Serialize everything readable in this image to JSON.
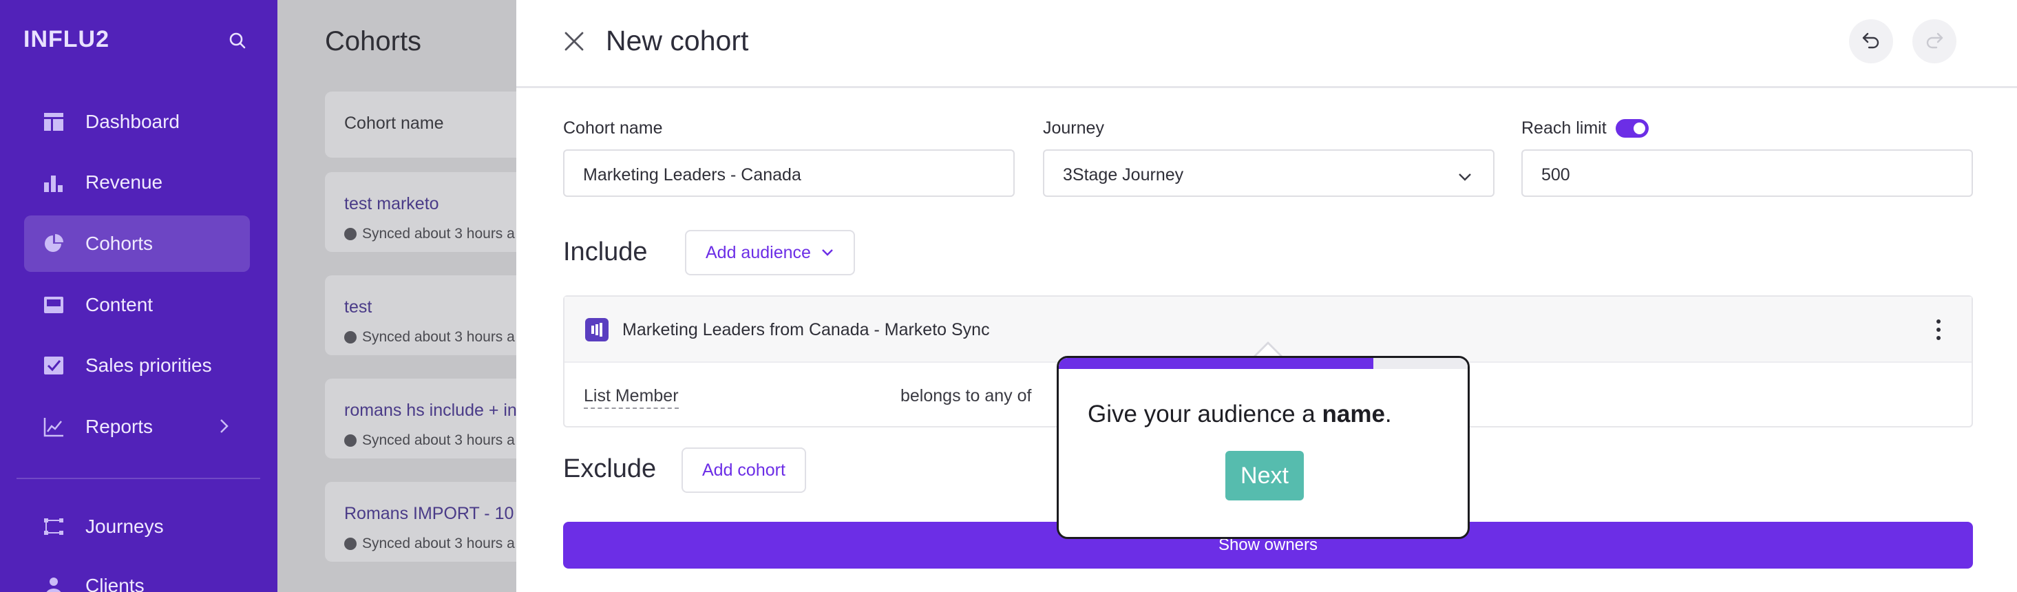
{
  "sidebar": {
    "brand": "INFLU2",
    "items": [
      {
        "label": "Dashboard",
        "icon": "dashboard-icon"
      },
      {
        "label": "Revenue",
        "icon": "bar-chart-icon"
      },
      {
        "label": "Cohorts",
        "icon": "pie-chart-icon",
        "active": true
      },
      {
        "label": "Content",
        "icon": "content-icon"
      },
      {
        "label": "Sales priorities",
        "icon": "checkbox-icon"
      },
      {
        "label": "Reports",
        "icon": "line-chart-icon"
      },
      {
        "label": "Journeys",
        "icon": "journeys-icon"
      },
      {
        "label": "Clients",
        "icon": "user-icon"
      }
    ]
  },
  "background_page": {
    "title": "Cohorts",
    "column_header": "Cohort name",
    "rows": [
      {
        "name": "test marketo",
        "status": "Synced about 3 hours a"
      },
      {
        "name": "test",
        "status": "Synced about 3 hours a"
      },
      {
        "name": "romans hs include + in",
        "status": "Synced about 3 hours a"
      },
      {
        "name": "Romans IMPORT - 10 t",
        "status": "Synced about 3 hours a"
      }
    ]
  },
  "panel": {
    "title": "New cohort",
    "cohort_name": {
      "label": "Cohort name",
      "value": "Marketing Leaders - Canada"
    },
    "journey": {
      "label": "Journey",
      "value": "3Stage Journey"
    },
    "reach_limit": {
      "label": "Reach limit",
      "value": "500",
      "enabled": true
    },
    "include": {
      "title": "Include",
      "add_button": "Add audience",
      "audience": {
        "name": "Marketing Leaders from Canada - Marketo Sync",
        "rule_field": "List Member",
        "rule_operator": "belongs to any of"
      }
    },
    "exclude": {
      "title": "Exclude",
      "add_button": "Add cohort"
    },
    "primary_button": "Show owners"
  },
  "tooltip": {
    "text_before": "Give your audience a ",
    "text_bold": "name",
    "text_after": ".",
    "next_label": "Next",
    "progress": 0.77
  },
  "colors": {
    "sidebar": "#5222b9",
    "accent": "#6c2ee6",
    "next_button": "#56bcae"
  }
}
